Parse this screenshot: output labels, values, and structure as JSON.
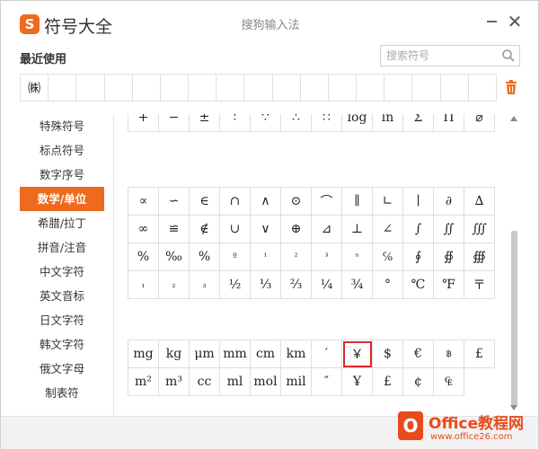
{
  "header": {
    "logo_glyph": "S",
    "title": "符号大全",
    "ime_name": "搜狗输入法",
    "close_glyph": "✕"
  },
  "recent": {
    "label": "最近使用",
    "items": [
      "㈱",
      "",
      "",
      "",
      "",
      "",
      "",
      "",
      "",
      "",
      "",
      "",
      "",
      "",
      "",
      "",
      ""
    ]
  },
  "search": {
    "placeholder": "搜索符号"
  },
  "sidebar": {
    "items": [
      {
        "label": "特殊符号",
        "active": false
      },
      {
        "label": "标点符号",
        "active": false
      },
      {
        "label": "数字序号",
        "active": false
      },
      {
        "label": "数学/单位",
        "active": true
      },
      {
        "label": "希腊/拉丁",
        "active": false
      },
      {
        "label": "拼音/注音",
        "active": false
      },
      {
        "label": "中文字符",
        "active": false
      },
      {
        "label": "英文音标",
        "active": false
      },
      {
        "label": "日文字符",
        "active": false
      },
      {
        "label": "韩文字符",
        "active": false
      },
      {
        "label": "俄文字母",
        "active": false
      },
      {
        "label": "制表符",
        "active": false
      }
    ]
  },
  "math_grid": {
    "row1": [
      "+",
      "−",
      "±",
      "∶",
      "∵",
      "∴",
      "∷",
      "log",
      "ln",
      "Σ",
      "Π",
      "⌀"
    ],
    "rows": [
      [
        "∝",
        "∽",
        "∈",
        "∩",
        "∧",
        "⊙",
        "⌒",
        "∥",
        "∟",
        "∣",
        "∂",
        "∆"
      ],
      [
        "∞",
        "≌",
        "∉",
        "∪",
        "∨",
        "⊕",
        "⊿",
        "⊥",
        "∠",
        "∫",
        "∬",
        "∭"
      ],
      [
        "%",
        "‰",
        "%",
        "º",
        "¹",
        "²",
        "³",
        "ⁿ",
        "℅",
        "∮",
        "∯",
        "∰"
      ],
      [
        "₁",
        "₂",
        "₃",
        "½",
        "⅓",
        "⅔",
        "¼",
        "¾",
        "°",
        "℃",
        "℉",
        "〒"
      ]
    ]
  },
  "unit_grid": {
    "rows": [
      [
        "mg",
        "kg",
        "μm",
        "mm",
        "cm",
        "km",
        "′",
        "￥",
        "$",
        "€",
        "฿",
        "£"
      ],
      [
        "m²",
        "m³",
        "cc",
        "ml",
        "mol",
        "mil",
        "″",
        "Ұ",
        "£",
        "¢",
        "₠",
        ""
      ]
    ],
    "selected_symbol": "￥"
  },
  "watermark": {
    "icon": "O",
    "brand": "Office教程网",
    "url": "www.office26.com"
  },
  "colors": {
    "accent": "#ee6a1e",
    "selection": "#e3262b"
  }
}
